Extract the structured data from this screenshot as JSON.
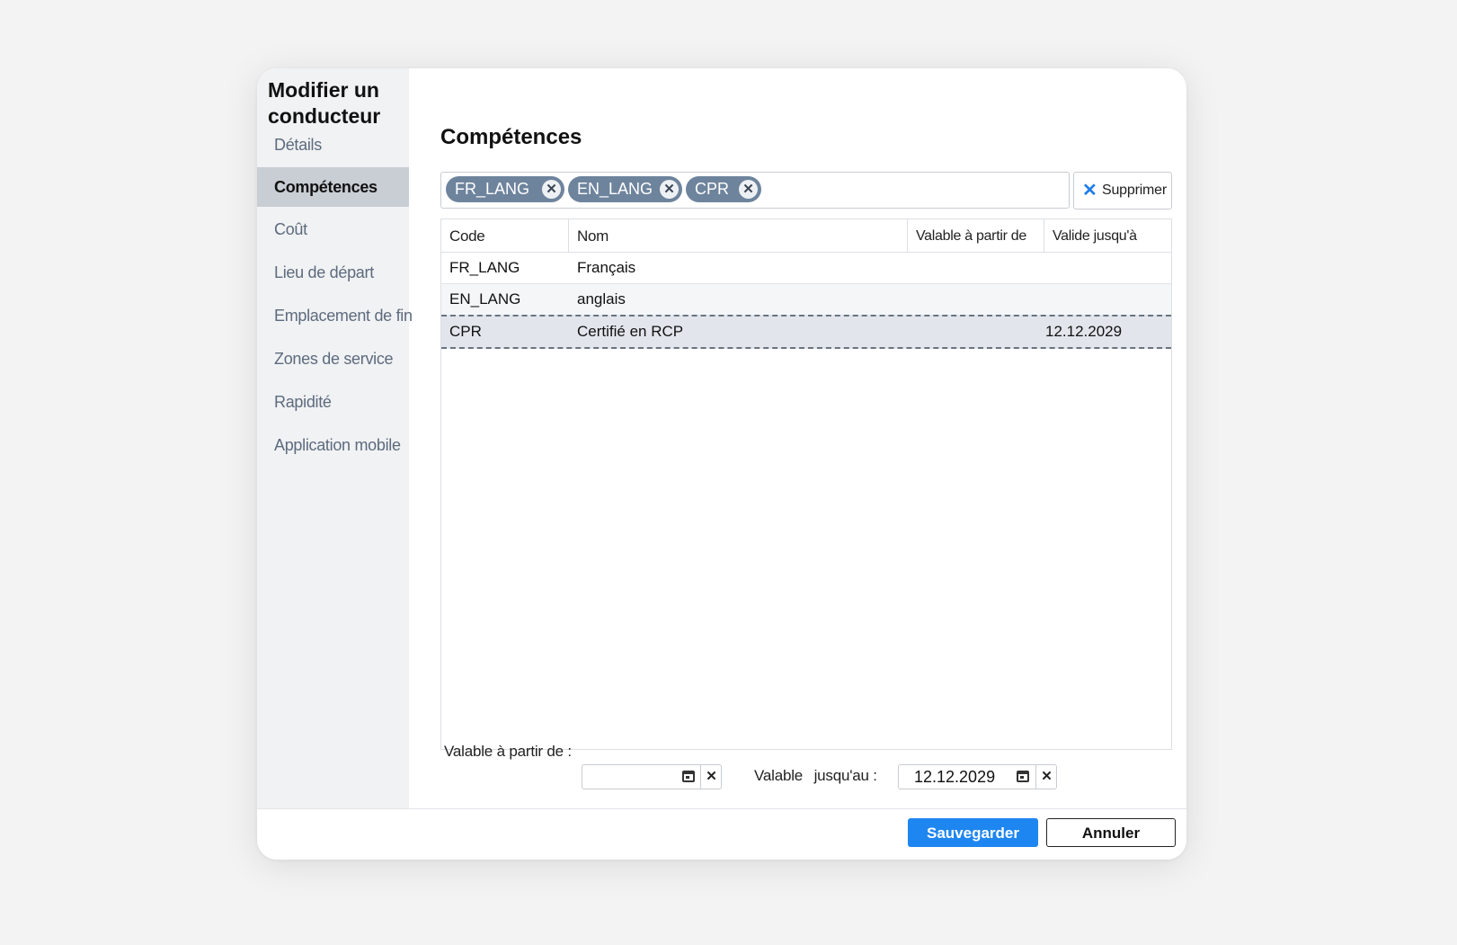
{
  "dialog": {
    "title": "Modifier un conducteur"
  },
  "sidebar": {
    "items": [
      {
        "label": "Détails",
        "active": false
      },
      {
        "label": "Compétences",
        "active": true
      },
      {
        "label": "Coût",
        "active": false
      },
      {
        "label": "Lieu de départ",
        "active": false
      },
      {
        "label": "Emplacement de fin",
        "active": false
      },
      {
        "label": "Zones de service",
        "active": false
      },
      {
        "label": "Rapidité",
        "active": false
      },
      {
        "label": "Application mobile",
        "active": false
      }
    ]
  },
  "main": {
    "title": "Compétences",
    "tags": [
      "FR_LANG",
      "EN_LANG",
      "CPR"
    ],
    "tag_remove_glyph": "✕",
    "dropdown_glyph": "⌄",
    "delete_button": {
      "icon": "close-icon",
      "glyph": "✕",
      "label": "Supprimer"
    },
    "table": {
      "headers": [
        "Code",
        "Nom",
        "Valable à partir de",
        "Valide jusqu'à"
      ],
      "rows": [
        {
          "code": "FR_LANG",
          "name": "Français",
          "from": "",
          "until": ""
        },
        {
          "code": "EN_LANG",
          "name": "anglais",
          "from": "",
          "until": ""
        },
        {
          "code": "CPR",
          "name": "Certifié en RCP",
          "from": "",
          "until": "12.12.2029",
          "selected": true
        }
      ]
    },
    "date_from": {
      "label": "Valable à partir de :",
      "value": "",
      "clear_glyph": "✕"
    },
    "date_until": {
      "label_a": "Valable",
      "label_b": "jusqu'au :",
      "value": "12.12.2029",
      "clear_glyph": "✕"
    }
  },
  "footer": {
    "save_label": "Sauvegarder",
    "cancel_label": "Annuler"
  },
  "colors": {
    "accent": "#1e86f0",
    "tag": "#6e849d",
    "sidebar_active": "#c9ced5"
  }
}
